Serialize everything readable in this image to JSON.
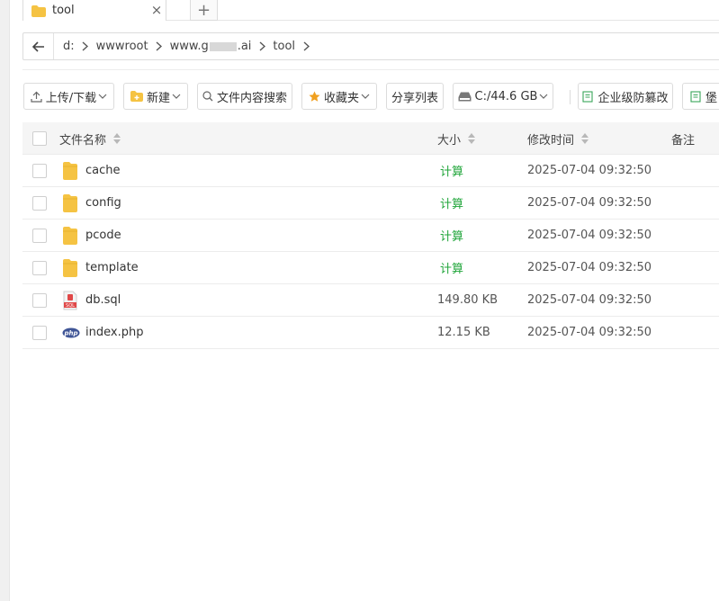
{
  "tab": {
    "title": "tool",
    "close": "×",
    "add": "+"
  },
  "breadcrumb": {
    "drive": "d:",
    "items": [
      "wwwroot",
      "www.g",
      ".ai",
      "tool"
    ]
  },
  "toolbar": {
    "upload": "上传/下载",
    "new": "新建",
    "search_content": "文件内容搜索",
    "favorites": "收藏夹",
    "share_list": "分享列表",
    "disk": "C:/44.6 GB",
    "tamper_protect": "企业级防篡改",
    "last_partial": "堡"
  },
  "table": {
    "headers": {
      "name": "文件名称",
      "size": "大小",
      "modified": "修改时间",
      "remark": "备注"
    },
    "rows": [
      {
        "name": "cache",
        "type": "folder",
        "size": "计算",
        "modified": "2025-07-04 09:32:50"
      },
      {
        "name": "config",
        "type": "folder",
        "size": "计算",
        "modified": "2025-07-04 09:32:50"
      },
      {
        "name": "pcode",
        "type": "folder",
        "size": "计算",
        "modified": "2025-07-04 09:32:50"
      },
      {
        "name": "template",
        "type": "folder",
        "size": "计算",
        "modified": "2025-07-04 09:32:50"
      },
      {
        "name": "db.sql",
        "type": "sql",
        "size": "149.80 KB",
        "modified": "2025-07-04 09:32:50"
      },
      {
        "name": "index.php",
        "type": "php",
        "size": "12.15 KB",
        "modified": "2025-07-04 09:32:50"
      }
    ]
  },
  "icons": {
    "sql_label": "SQL",
    "php_label": "php"
  },
  "colors": {
    "calc_green": "#20a53a",
    "folder": "#f5c343",
    "star": "#f0a020"
  }
}
